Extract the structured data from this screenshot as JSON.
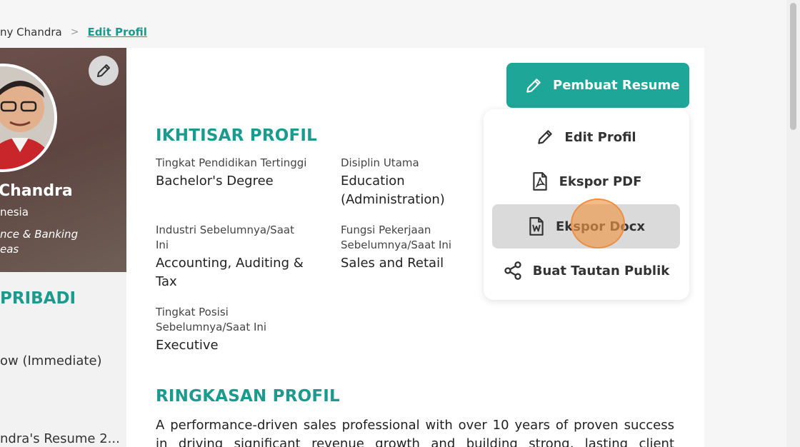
{
  "breadcrumb": {
    "previous": "ny Chandra",
    "separator": ">",
    "current": "Edit Profil"
  },
  "profile_card": {
    "name": "Chandra",
    "country": "nesia",
    "industry_line1": "nce & Banking",
    "industry_line2": "eas"
  },
  "sidebar": {
    "section_title": "PRIBADI",
    "availability": "ow (Immediate)",
    "resume_file": "ndra's Resume 2..."
  },
  "overview": {
    "title": "IKHTISAR PROFIL",
    "fields": [
      {
        "label": "Tingkat Pendidikan Tertinggi",
        "value": "Bachelor's Degree"
      },
      {
        "label": "Disiplin Utama",
        "value": "Education (Administration)"
      },
      {
        "label": "Industri Sebelumnya/Saat Ini",
        "value": "Accounting, Auditing & Tax"
      },
      {
        "label": "Fungsi Pekerjaan Sebelumnya/Saat Ini",
        "value": "Sales and Retail"
      },
      {
        "label": "Tingkat Posisi Sebelumnya/Saat Ini",
        "value": "Executive"
      }
    ]
  },
  "summary": {
    "title": "RINGKASAN PROFIL",
    "text": "A performance-driven sales professional with over 10 years of proven success in driving significant revenue growth and building strong, lasting client"
  },
  "resume_builder": {
    "label": "Pembuat Resume"
  },
  "menu": {
    "items": [
      {
        "label": "Edit Profil",
        "icon": "pencil-icon"
      },
      {
        "label": "Ekspor PDF",
        "icon": "pdf-file-icon"
      },
      {
        "label": "Ekspor Docx",
        "icon": "docx-file-icon"
      },
      {
        "label": "Buat Tautan Publik",
        "icon": "share-icon"
      }
    ]
  },
  "colors": {
    "accent": "#1ea698",
    "accent_text": "#1c9a8d",
    "menu_active": "#dadada",
    "click_marker": "#f0964680"
  }
}
